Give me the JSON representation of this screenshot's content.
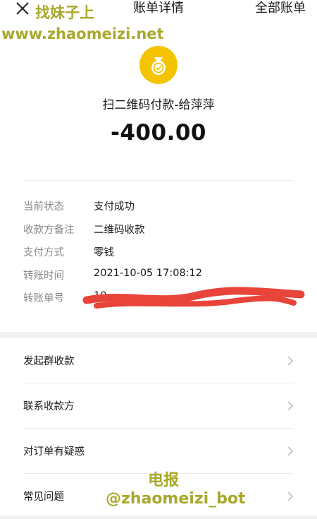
{
  "header": {
    "title": "账单详情",
    "right_link": "全部账单"
  },
  "transaction": {
    "title": "扫二维码付款-给萍萍",
    "amount": "-400.00",
    "icon": "money-bag-icon"
  },
  "details": [
    {
      "label": "当前状态",
      "value": "支付成功"
    },
    {
      "label": "收款方备注",
      "value": "二维码收款"
    },
    {
      "label": "支付方式",
      "value": "零钱"
    },
    {
      "label": "转账时间",
      "value": "2021-10-05 17:08:12"
    },
    {
      "label": "转账单号",
      "value": "10"
    }
  ],
  "actions": [
    {
      "label": "发起群收款"
    },
    {
      "label": "联系收款方"
    },
    {
      "label": "对订单有疑惑"
    },
    {
      "label": "常见问题"
    }
  ],
  "watermark": {
    "top_name": "找妹子上",
    "top_url": "www.zhaomeizi.net",
    "bottom_label": "电报",
    "bottom_handle": "@zhaomeizi_bot"
  },
  "colors": {
    "icon_bg": "#f5c400",
    "redaction": "#e8443a",
    "watermark": "#a8a82c"
  }
}
